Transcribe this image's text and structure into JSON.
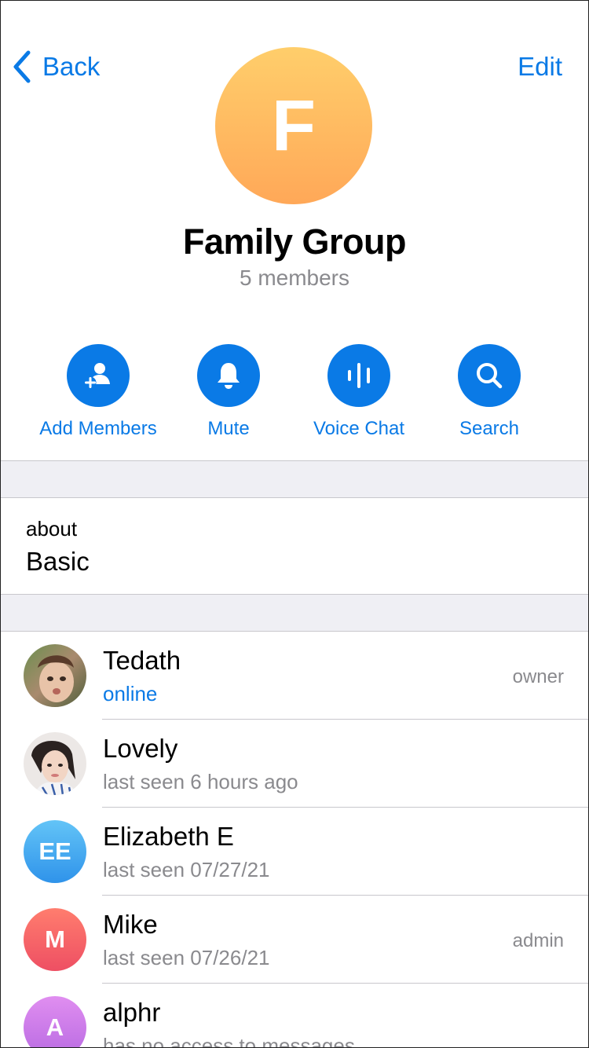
{
  "nav": {
    "back_label": "Back",
    "edit_label": "Edit"
  },
  "group": {
    "initial": "F",
    "title": "Family Group",
    "subtitle": "5 members"
  },
  "actions": [
    {
      "label": "Add Members",
      "icon": "add-member-icon"
    },
    {
      "label": "Mute",
      "icon": "bell-icon"
    },
    {
      "label": "Voice Chat",
      "icon": "voice-wave-icon"
    },
    {
      "label": "Search",
      "icon": "search-icon"
    }
  ],
  "about": {
    "key": "about",
    "value": "Basic"
  },
  "members": [
    {
      "name": "Tedath",
      "status": "online",
      "role": "owner",
      "avatar": "photo"
    },
    {
      "name": "Lovely",
      "status": "last seen 6 hours ago",
      "role": "",
      "avatar": "photo"
    },
    {
      "name": "Elizabeth E",
      "status": "last seen 07/27/21",
      "role": "",
      "avatar": "EE"
    },
    {
      "name": "Mike",
      "status": "last seen 07/26/21",
      "role": "admin",
      "avatar": "M"
    },
    {
      "name": "alphr",
      "status": "has no access to messages",
      "role": "",
      "avatar": "A"
    }
  ],
  "colors": {
    "accent": "#0a7ae6",
    "secondary_text": "#8a8a8e",
    "group_avatar_top": "#ffce6b",
    "group_avatar_bottom": "#ffa858",
    "avatar_ee": "#3aa3ef",
    "avatar_m": "#f05c5c",
    "avatar_a": "#c77ce6"
  }
}
